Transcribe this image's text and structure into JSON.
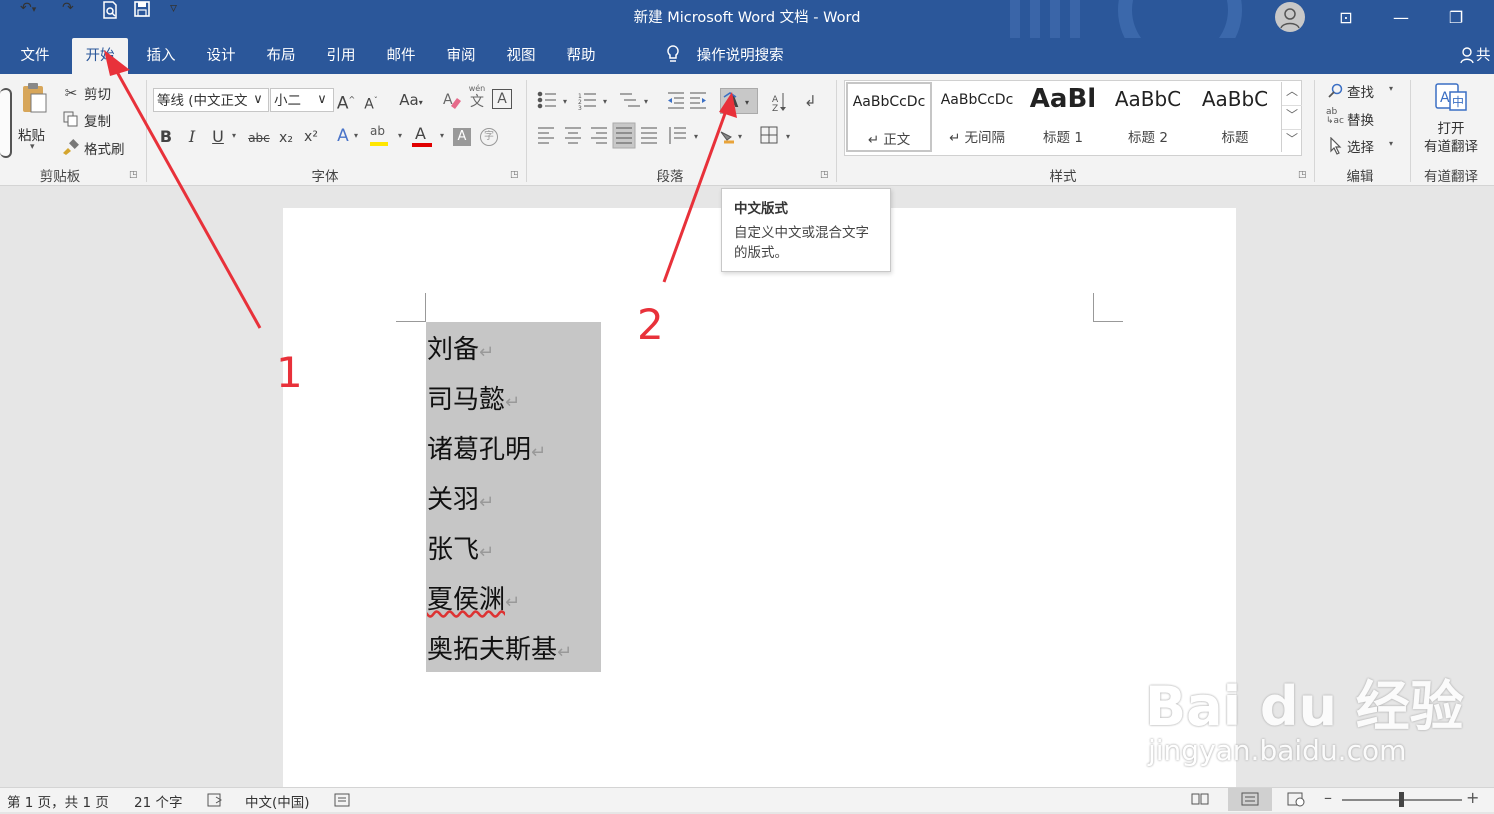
{
  "window": {
    "title": "新建 Microsoft Word 文档 - Word"
  },
  "quick_access": {
    "undo": "↶",
    "redo": "↷",
    "customize": "▿"
  },
  "window_controls": {
    "ribbon_display": "⊡",
    "minimize": "—",
    "restore": "❐"
  },
  "tabs": [
    {
      "label": "文件"
    },
    {
      "label": "开始"
    },
    {
      "label": "插入"
    },
    {
      "label": "设计"
    },
    {
      "label": "布局"
    },
    {
      "label": "引用"
    },
    {
      "label": "邮件"
    },
    {
      "label": "审阅"
    },
    {
      "label": "视图"
    },
    {
      "label": "帮助"
    }
  ],
  "tell_me": "操作说明搜索",
  "share": "共",
  "clipboard": {
    "paste": "粘贴",
    "cut": "剪切",
    "copy": "复制",
    "format_painter": "格式刷",
    "group": "剪贴板"
  },
  "font": {
    "name": "等线 (中文正文",
    "size": "小二",
    "group": "字体",
    "change_case": "Aa",
    "phonetic": "wén",
    "phonetic_char": "文",
    "bold": "B",
    "italic": "I",
    "underline": "U",
    "strike": "abc",
    "subscript": "x₂",
    "superscript": "x²",
    "grow": "A",
    "shrink": "A",
    "border_char": "A",
    "text_effects": "A",
    "highlight": "ab",
    "font_color": "A",
    "shading": "A",
    "enclose": "字"
  },
  "paragraph": {
    "group": "段落"
  },
  "styles": {
    "group": "样式",
    "items": [
      {
        "sample": "AaBbCcDc",
        "name": "↵ 正文"
      },
      {
        "sample": "AaBbCcDc",
        "name": "↵ 无间隔"
      },
      {
        "sample": "AaBl",
        "name": "标题 1"
      },
      {
        "sample": "AaBbC",
        "name": "标题 2"
      },
      {
        "sample": "AaBbC",
        "name": "标题"
      }
    ]
  },
  "editing": {
    "find": "查找",
    "replace": "替换",
    "select": "选择",
    "group": "编辑"
  },
  "youdao": {
    "open": "打开",
    "translate": "有道翻译",
    "group": "有道翻译"
  },
  "tooltip": {
    "title": "中文版式",
    "body_line1": "自定义中文或混合文字",
    "body_line2": "的版式。"
  },
  "document": {
    "lines": [
      "刘备",
      "司马懿",
      "诸葛孔明",
      "关羽",
      "张飞",
      "夏侯渊",
      "奥拓夫斯基"
    ],
    "return_mark": "↵"
  },
  "annotations": {
    "one": "1",
    "two": "2"
  },
  "status": {
    "page": "第 1 页，共 1 页",
    "words": "21 个字",
    "language": "中文(中国)"
  },
  "watermark": {
    "logo": "Bai du 经验",
    "url": "jingyan.baidu.com"
  },
  "colors": {
    "title_bar": "#2b579a",
    "annotation": "#e8313a",
    "selection": "#c6c6c6"
  }
}
